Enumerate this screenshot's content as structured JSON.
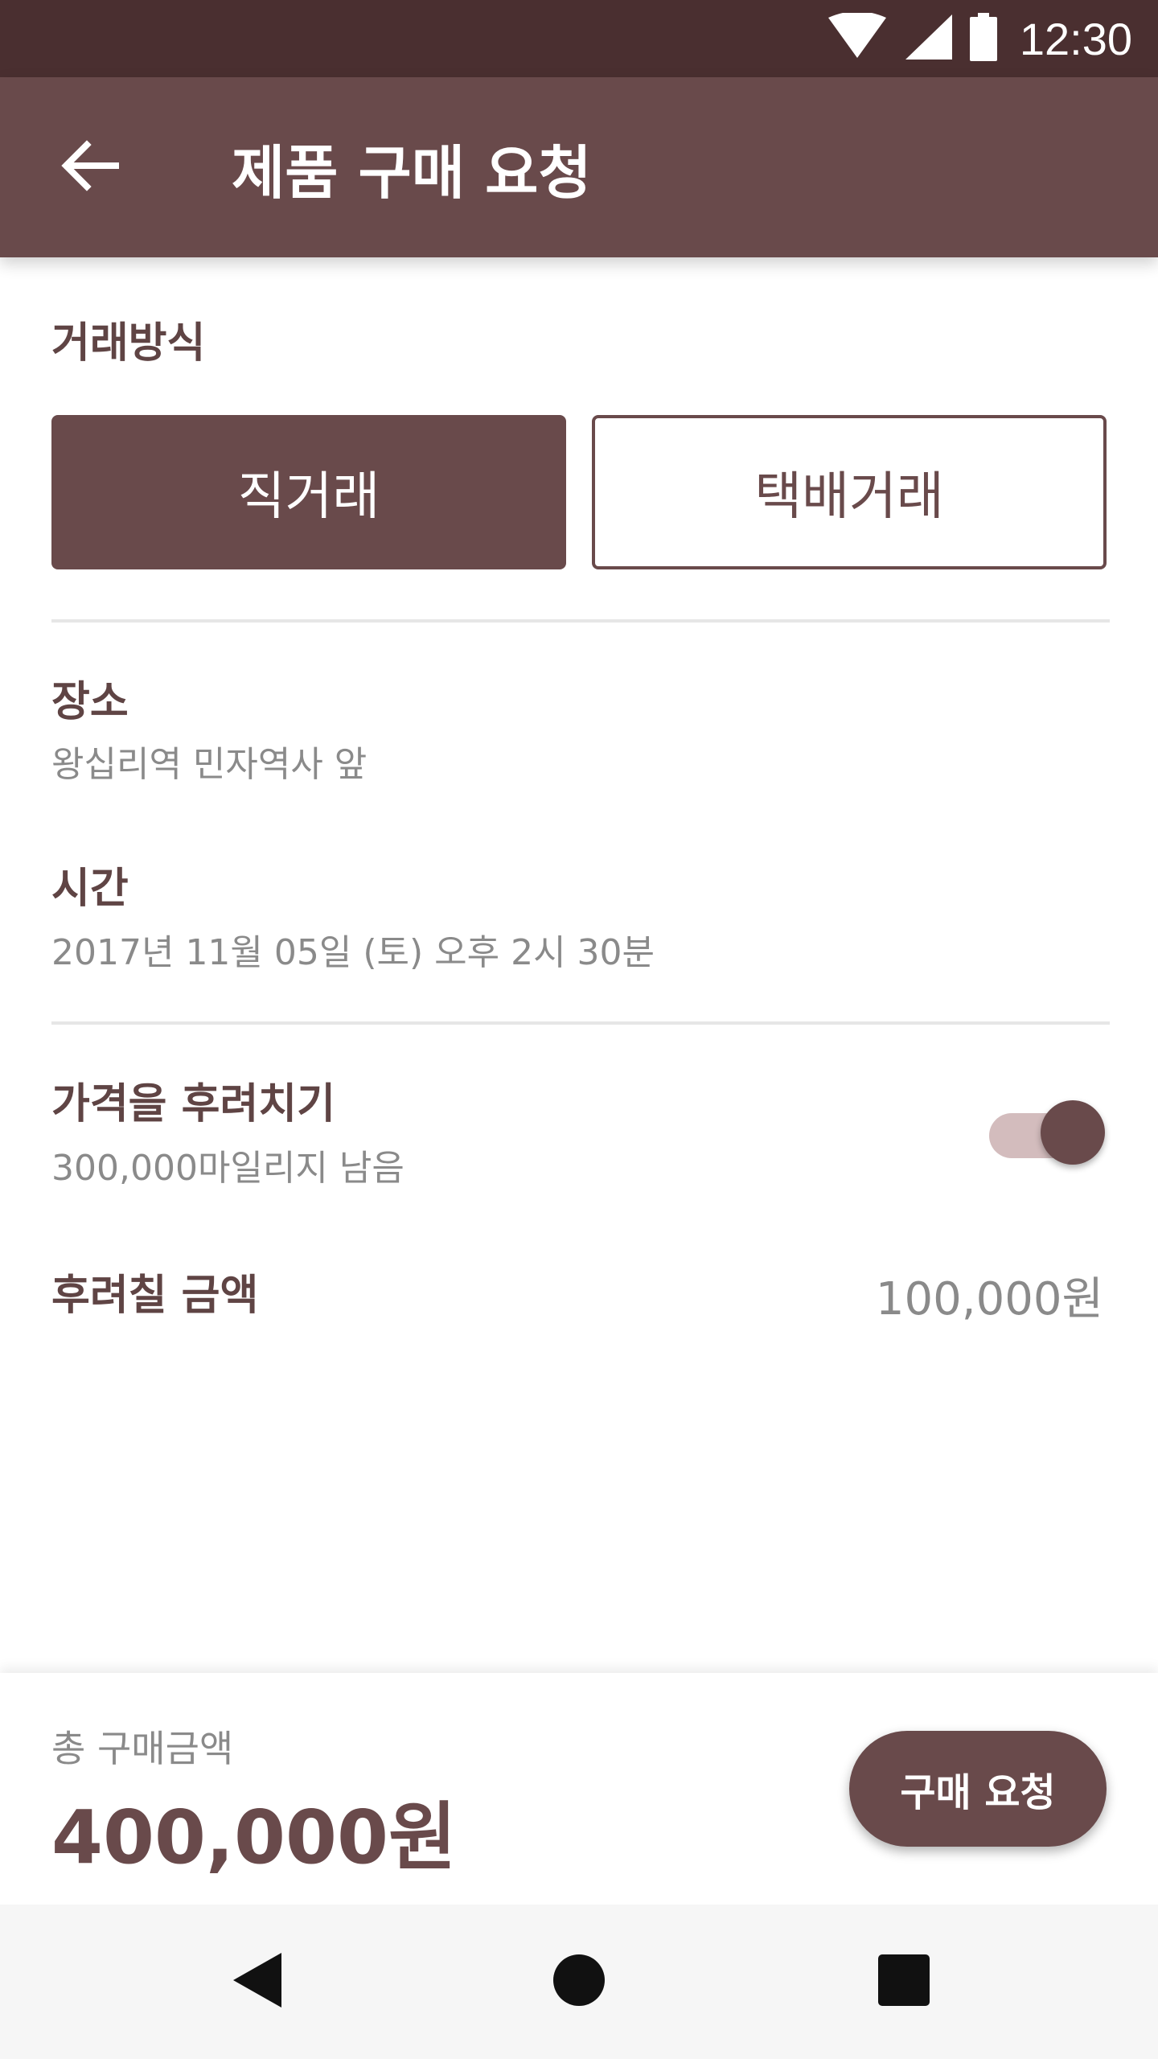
{
  "status_bar": {
    "time": "12:30"
  },
  "app_bar": {
    "title": "제품 구매 요청"
  },
  "trade_method": {
    "label": "거래방식",
    "options": [
      "직거래",
      "택배거래"
    ],
    "selected": "직거래"
  },
  "place": {
    "label": "장소",
    "value": "왕십리역 민자역사 앞"
  },
  "time": {
    "label": "시간",
    "value": "2017년 11월 05일 (토) 오후 2시 30분"
  },
  "mileage": {
    "label": "가격을 후려치기",
    "remaining": "300,000마일리지 남음",
    "toggle_on": true
  },
  "discount": {
    "label": "후려칠 금액",
    "value": "100,000원"
  },
  "total": {
    "label": "총 구매금액",
    "value": "400,000원"
  },
  "buttons": {
    "request": "구매 요청"
  },
  "colors": {
    "primary": "#694a4b",
    "status_bar": "#4a2f30",
    "toggle_track": "#d3bcbd",
    "secondary_text": "#8a8a8a"
  },
  "icons": {
    "back": "arrow-left-icon",
    "wifi": "wifi-icon",
    "signal": "signal-icon",
    "battery": "battery-icon",
    "nav_back": "nav-back-icon",
    "nav_home": "nav-home-icon",
    "nav_recents": "nav-recents-icon"
  }
}
